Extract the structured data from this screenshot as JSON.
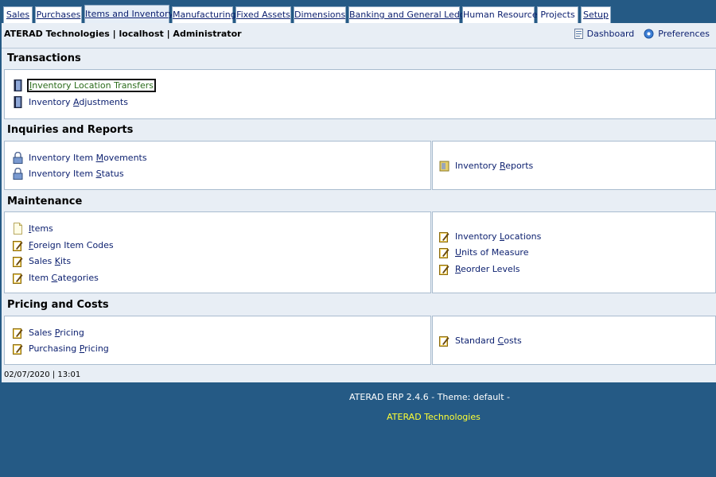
{
  "tabs": [
    {
      "pre": "",
      "acc": "S",
      "post": "ales"
    },
    {
      "pre": "",
      "acc": "P",
      "post": "urchases"
    },
    {
      "pre": "",
      "acc": "I",
      "post": "tems and Inventory"
    },
    {
      "pre": "",
      "acc": "M",
      "post": "anufacturing"
    },
    {
      "pre": "",
      "acc": "F",
      "post": "ixed Assets"
    },
    {
      "pre": "",
      "acc": "D",
      "post": "imensions"
    },
    {
      "pre": "",
      "acc": "B",
      "post": "anking and General Ledger"
    },
    {
      "pre": "Human Resource",
      "acc": "",
      "post": ""
    },
    {
      "pre": "Projects",
      "acc": "",
      "post": ""
    },
    {
      "pre": "S",
      "acc": "e",
      "post": "tup"
    }
  ],
  "header": {
    "info": "ATERAD Technologies | localhost | Administrator",
    "dashboard": "Dashboard",
    "preferences": "Preferences"
  },
  "sections": {
    "transactions": "Transactions",
    "inquiries": "Inquiries and Reports",
    "maintenance": "Maintenance",
    "pricing": "Pricing and Costs"
  },
  "items": {
    "loc_transfers": {
      "pre": "",
      "acc": "I",
      "post": "nventory Location Transfers"
    },
    "adjustments": {
      "pre": "Inventory ",
      "acc": "A",
      "post": "djustments"
    },
    "movements": {
      "pre": "Inventory Item ",
      "acc": "M",
      "post": "ovements"
    },
    "status": {
      "pre": "Inventory Item ",
      "acc": "S",
      "post": "tatus"
    },
    "reports": {
      "pre": "Inventory ",
      "acc": "R",
      "post": "eports"
    },
    "items": {
      "pre": "",
      "acc": "I",
      "post": "tems"
    },
    "foreign_codes": {
      "pre": "",
      "acc": "F",
      "post": "oreign Item Codes"
    },
    "sales_kits": {
      "pre": "Sales ",
      "acc": "K",
      "post": "its"
    },
    "categories": {
      "pre": "Item ",
      "acc": "C",
      "post": "ategories"
    },
    "locations": {
      "pre": "Inventory ",
      "acc": "L",
      "post": "ocations"
    },
    "units": {
      "pre": "",
      "acc": "U",
      "post": "nits of Measure"
    },
    "reorder": {
      "pre": "",
      "acc": "R",
      "post": "eorder Levels"
    },
    "sales_pricing": {
      "pre": "Sales ",
      "acc": "P",
      "post": "ricing"
    },
    "purchasing_pricing": {
      "pre": "Purchasing ",
      "acc": "P",
      "post": "ricing"
    },
    "standard_costs": {
      "pre": "Standard ",
      "acc": "C",
      "post": "osts"
    }
  },
  "datetime": "02/07/2020 | 13:01",
  "footer": {
    "version": "ATERAD ERP 2.4.6 - Theme: default -",
    "company": "ATERAD Technologies"
  },
  "colors": {
    "background": "#255a85",
    "link": "#0a1e6e",
    "footer_accent": "#ffff33"
  }
}
